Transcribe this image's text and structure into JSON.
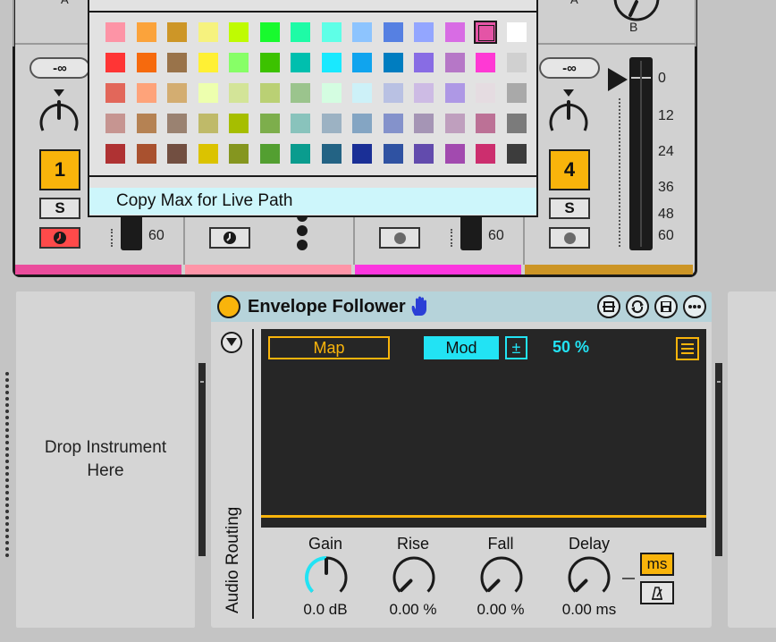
{
  "mixer": {
    "send_a": "A",
    "send_b": "B",
    "strips": [
      {
        "volume": "-∞",
        "number": "1",
        "solo": "S",
        "color": "#ea4c9c",
        "arm_active": true
      },
      {
        "volume": "",
        "number": "",
        "solo": "",
        "color": "#fe95a8",
        "arm_active": false
      },
      {
        "volume": "",
        "number": "",
        "solo": "",
        "color": "#fc36df",
        "arm_active": false
      },
      {
        "volume": "-∞",
        "number": "4",
        "solo": "S",
        "color": "#cc9526",
        "arm_active": false
      }
    ],
    "meter_scale": [
      "0",
      "12",
      "24",
      "36",
      "48",
      "60"
    ],
    "meter_partial_48": "48",
    "meter_partial_60": "60"
  },
  "color_menu": {
    "swatches": [
      [
        "#fd94a6",
        "#fba33b",
        "#cd9627",
        "#f6f27e",
        "#bffb02",
        "#18fa2e",
        "#1efba6",
        "#5effe7",
        "#8dc4fe",
        "#5680e2",
        "#93a6ff",
        "#d86ce4",
        "#e454a6",
        "#ffffff"
      ],
      [
        "#ff3535",
        "#f66a0d",
        "#99734a",
        "#fff034",
        "#87ff67",
        "#3cc200",
        "#00bfae",
        "#19e9ff",
        "#10a4ee",
        "#007dc0",
        "#886ce4",
        "#b677c7",
        "#ff39d4",
        "#d0d0d0"
      ],
      [
        "#e2675a",
        "#fea37a",
        "#d3ad71",
        "#edffae",
        "#d3e498",
        "#bad074",
        "#9bc48d",
        "#d4fde1",
        "#cdf1f8",
        "#b9c1e3",
        "#cdbbe4",
        "#ae98e5",
        "#e5dce1",
        "#a9a9a9"
      ],
      [
        "#c69591",
        "#b58253",
        "#9a8271",
        "#bfba69",
        "#a6be00",
        "#7dae4c",
        "#89c3bc",
        "#9cb2c3",
        "#84a5c3",
        "#8492cb",
        "#a595b5",
        "#bf9fbe",
        "#bc7196",
        "#7b7b7b"
      ],
      [
        "#af3233",
        "#a9512f",
        "#724f41",
        "#dbc300",
        "#85961f",
        "#539f31",
        "#0a9c8e",
        "#236384",
        "#1a2f96",
        "#2f52a2",
        "#624bad",
        "#a24aaf",
        "#cc2e6e",
        "#3c3c3c"
      ]
    ],
    "selected": "#e454a6",
    "item": "Copy Max for Live Path"
  },
  "drop_zone": {
    "line1": "Drop Instrument",
    "line2": "Here"
  },
  "device": {
    "title": "Envelope Follower",
    "routing_label": "Audio Routing",
    "map_label": "Map",
    "mod_label": "Mod",
    "plusminus": "±",
    "percent": "50 %",
    "knobs": [
      {
        "label": "Gain",
        "value": "0.0 dB",
        "level": 0.5
      },
      {
        "label": "Rise",
        "value": "0.00 %",
        "level": 0.0
      },
      {
        "label": "Fall",
        "value": "0.00 %",
        "level": 0.0
      },
      {
        "label": "Delay",
        "value": "0.00 ms",
        "level": 0.0
      }
    ],
    "ms_label": "ms",
    "accent": "#22e3f4",
    "highlight": "#f9b40b"
  }
}
